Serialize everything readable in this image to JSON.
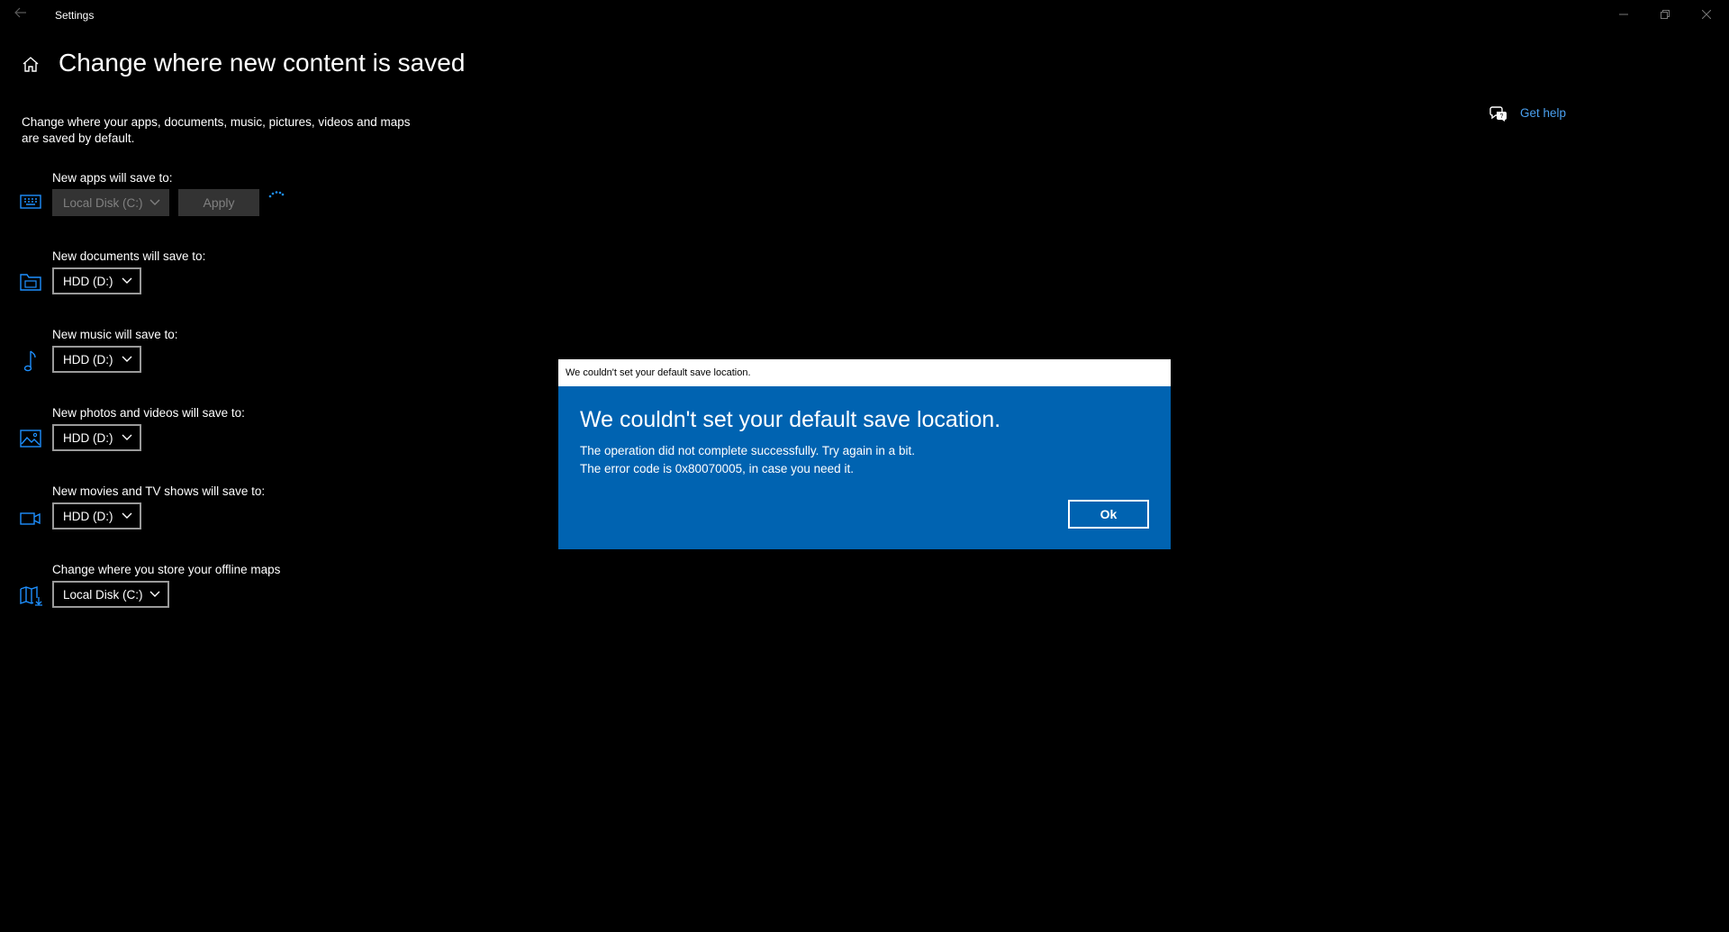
{
  "window": {
    "title": "Settings",
    "back_icon": "back-arrow-icon",
    "controls": [
      "minimize-icon",
      "restore-icon",
      "close-icon"
    ]
  },
  "header": {
    "title": "Change where new content is saved",
    "home_icon": "home-icon"
  },
  "description": "Change where your apps, documents, music, pictures, videos and maps are saved by default.",
  "help": {
    "label": "Get help",
    "icon": "get-help-chat-icon"
  },
  "settings": [
    {
      "label": "New apps will save to:",
      "value": "Local Disk (C:)",
      "icon": "monitor-keyboard-icon",
      "disabled": true,
      "apply_label": "Apply",
      "busy_icon": "progress-spinner-icon"
    },
    {
      "label": "New documents will save to:",
      "value": "HDD (D:)",
      "icon": "documents-folder-icon"
    },
    {
      "label": "New music will save to:",
      "value": "HDD (D:)",
      "icon": "music-note-icon"
    },
    {
      "label": "New photos and videos will save to:",
      "value": "HDD (D:)",
      "icon": "photo-icon"
    },
    {
      "label": "New movies and TV shows will save to:",
      "value": "HDD (D:)",
      "icon": "video-camera-icon"
    },
    {
      "label": "Change where you store your offline maps",
      "value": "Local Disk (C:)",
      "icon": "map-download-icon"
    }
  ],
  "dialog": {
    "title": "We couldn't set your default save location.",
    "heading": "We couldn't set your default save location.",
    "message_line1": "The operation did not complete successfully. Try again in a bit.",
    "message_line2": "The error code is 0x80070005, in case you need it.",
    "ok_label": "Ok"
  },
  "colors": {
    "background": "#000000",
    "accent": "#0063b1",
    "link": "#4aa0f0",
    "icon_blue": "#1e90ff",
    "disabled_fill": "#333333",
    "disabled_text": "#808080"
  }
}
